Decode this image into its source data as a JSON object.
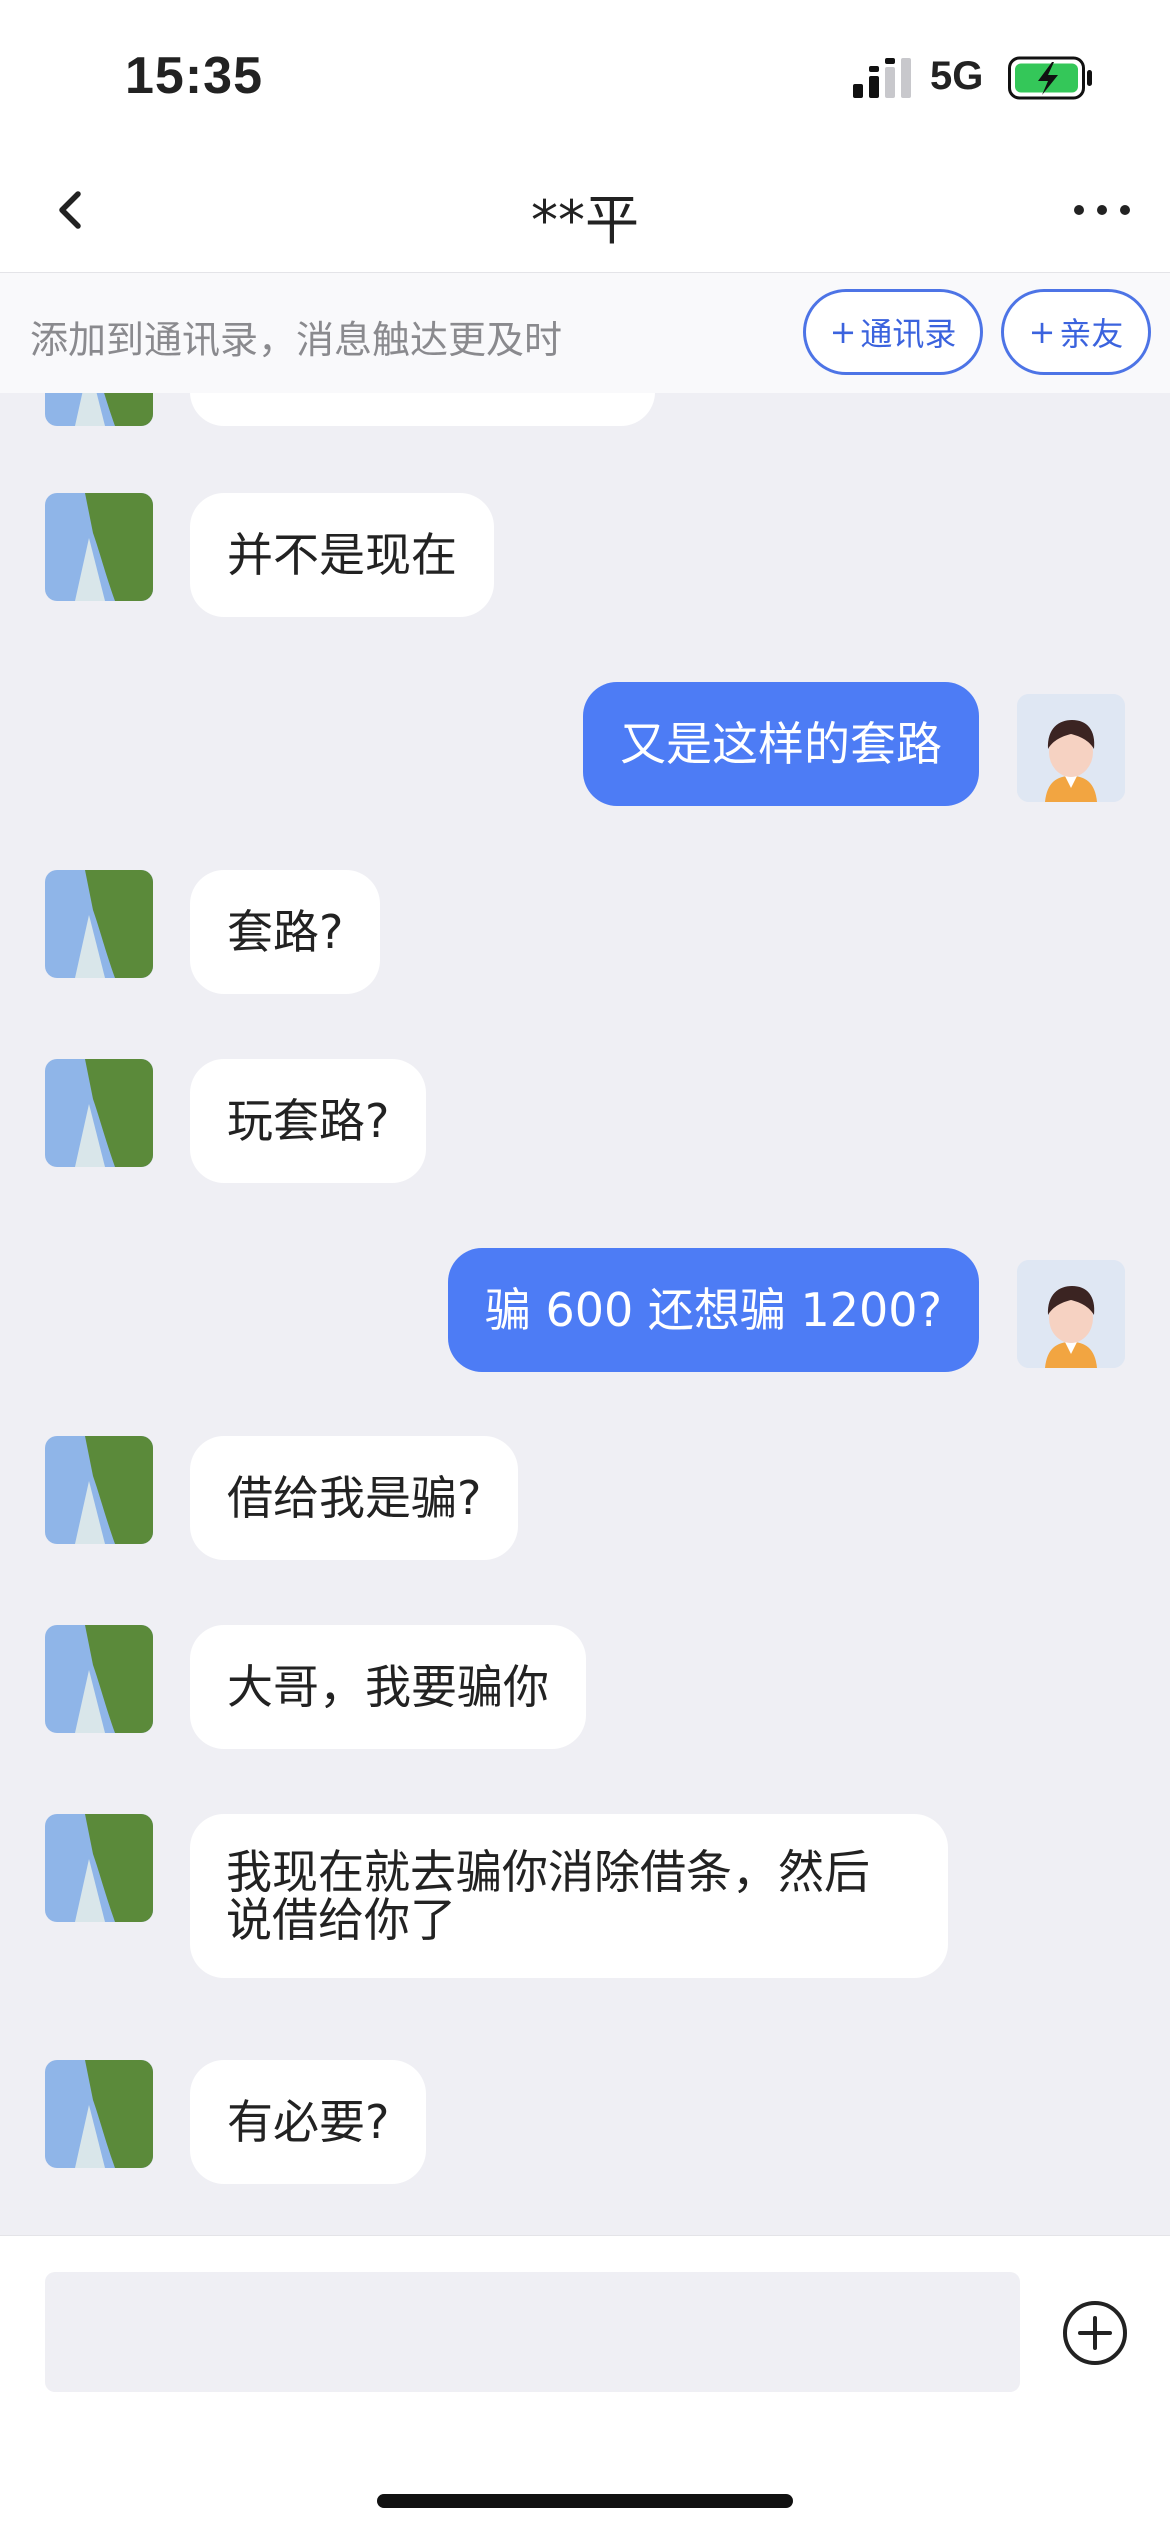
{
  "status_bar": {
    "time": "15:35",
    "network": "5G",
    "icons": [
      "signal-icon",
      "battery-charging-icon"
    ]
  },
  "nav": {
    "title": "**平",
    "icons": [
      "back-chevron-icon",
      "more-dots-icon"
    ]
  },
  "banner": {
    "text": "添加到通讯录，消息触达更及时",
    "plus": "+",
    "contacts_label": "通讯录",
    "family_label": "亲友"
  },
  "messages": [
    {
      "direction": "incoming",
      "text": ""
    },
    {
      "direction": "incoming",
      "text": "并不是现在"
    },
    {
      "direction": "outgoing",
      "text": "又是这样的套路"
    },
    {
      "direction": "incoming",
      "text": "套路?"
    },
    {
      "direction": "incoming",
      "text": "玩套路?"
    },
    {
      "direction": "outgoing",
      "text": "骗 600 还想骗 1200?"
    },
    {
      "direction": "incoming",
      "text": "借给我是骗?"
    },
    {
      "direction": "incoming",
      "text": "大哥，我要骗你"
    },
    {
      "direction": "incoming",
      "text": "我现在就去骗你消除借条，然后说借给你了"
    },
    {
      "direction": "incoming",
      "text": "有必要?"
    }
  ],
  "input": {
    "value": "",
    "placeholder": ""
  },
  "colors": {
    "background": "#efeff4",
    "outgoing_bubble": "#4d7cf5",
    "incoming_bubble": "#ffffff",
    "accent": "#3b63de"
  }
}
